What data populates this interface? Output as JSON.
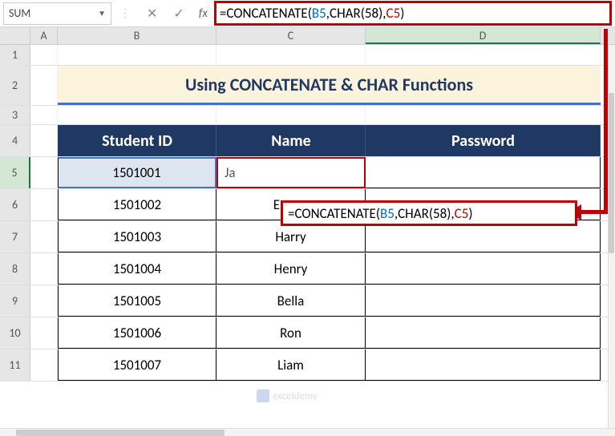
{
  "name_box": "SUM",
  "formula_bar": {
    "prefix": "=",
    "fn_open": "CONCATENATE(",
    "ref1": "B5",
    "sep1": ",CHAR(58),",
    "ref2": "C5",
    "close": ")"
  },
  "columns": [
    "A",
    "B",
    "C",
    "D"
  ],
  "rows": [
    "1",
    "2",
    "3",
    "4",
    "5",
    "6",
    "7",
    "8",
    "9",
    "10",
    "11"
  ],
  "title": "Using CONCATENATE & CHAR Functions",
  "headers": {
    "b": "Student ID",
    "c": "Name",
    "d": "Password"
  },
  "data": [
    {
      "id": "1501001",
      "name": "Ja"
    },
    {
      "id": "1501002",
      "name": "Emma"
    },
    {
      "id": "1501003",
      "name": "Harry"
    },
    {
      "id": "1501004",
      "name": "Henry"
    },
    {
      "id": "1501005",
      "name": "Bella"
    },
    {
      "id": "1501006",
      "name": "Ron"
    },
    {
      "id": "1501007",
      "name": "Liam"
    }
  ],
  "inline_formula": {
    "text1": "=CONCATENATE(",
    "ref1": "B5",
    "text2": ",CHAR(58),",
    "ref2": "C5",
    "text3": ")"
  },
  "watermark": "exceldemy"
}
